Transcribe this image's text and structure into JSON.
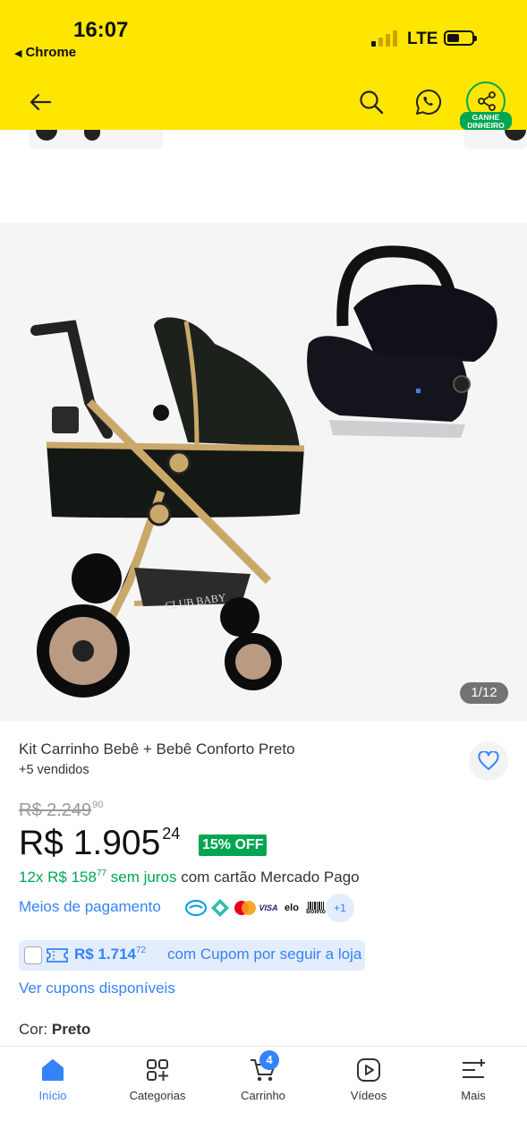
{
  "status_bar": {
    "time": "16:07",
    "back_app": "Chrome",
    "network": "LTE"
  },
  "header": {
    "share_badge": "GANHE DINHEIRO",
    "icons": [
      "back-arrow-icon",
      "search-icon",
      "whatsapp-icon",
      "share-icon"
    ],
    "background": "#ffe600"
  },
  "gallery": {
    "counter": "1/12",
    "brand_text": "CLUB BABY"
  },
  "product": {
    "title": "Kit Carrinho Bebê + Bebê Conforto Preto",
    "sold": "+5 vendidos",
    "old_price_int": "R$ 2.249",
    "old_price_cents": "90",
    "price_int": "R$ 1.905",
    "price_cents": "24",
    "discount": "15% OFF",
    "installments_main": "12x R$ 158",
    "installments_cents": "77",
    "installments_interest": " sem juros",
    "installments_card": " com cartão Mercado Pago",
    "payment_link": "Meios de pagamento",
    "payment_more": "+1",
    "payment_icons": [
      "VISA",
      "elo",
      "Boleto"
    ],
    "coupon_amount": "R$ 1.714",
    "coupon_cents": "72",
    "coupon_text": "com Cupom por seguir a loja",
    "coupons_link": "Ver cupons disponíveis",
    "color_label": "Cor:",
    "color_value": "Preto"
  },
  "tabbar": {
    "items": [
      {
        "label": "Início",
        "icon": "home-icon",
        "active": true
      },
      {
        "label": "Categorias",
        "icon": "categories-icon",
        "active": false
      },
      {
        "label": "Carrinho",
        "icon": "cart-icon",
        "active": false
      },
      {
        "label": "Vídeos",
        "icon": "video-icon",
        "active": false
      },
      {
        "label": "Mais",
        "icon": "menu-more-icon",
        "active": false
      }
    ],
    "cart_count": "4"
  },
  "colors": {
    "brand_yellow": "#ffe600",
    "link_blue": "#3483fa",
    "success_green": "#00a650"
  }
}
